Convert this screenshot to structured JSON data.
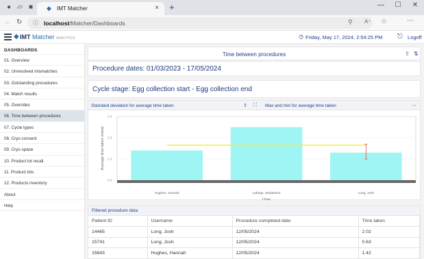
{
  "browser": {
    "tab_title": "IMT Matcher",
    "url_host": "localhost",
    "url_path": "/Matcher/Dashboards",
    "new_tab_glyph": "+",
    "close_glyph": "×"
  },
  "header": {
    "logo_imt": "IMT",
    "logo_matcher": "Matcher",
    "logo_sub": "ANALYTICS",
    "datetime": "Friday, May 17, 2024, 2:54:25 PM",
    "logoff": "Logoff"
  },
  "sidebar": {
    "heading": "DASHBOARDS",
    "items": [
      {
        "label": "01. Overview"
      },
      {
        "label": "02. Unresolved mismatches"
      },
      {
        "label": "03. Outstanding procedures"
      },
      {
        "label": "04. Match results"
      },
      {
        "label": "05. Overrides"
      },
      {
        "label": "06. Time between procedures"
      },
      {
        "label": "07. Cycle types"
      },
      {
        "label": "08. Cryo consent"
      },
      {
        "label": "09. Cryo space"
      },
      {
        "label": "10. Product lot recall"
      },
      {
        "label": "11. Product lots"
      },
      {
        "label": "12. Products inventory"
      },
      {
        "label": "About"
      },
      {
        "label": "Help"
      }
    ],
    "active_index": 5
  },
  "main": {
    "title": "Time between procedures",
    "procedure_dates": "Procedure dates: 01/03/2023 - 17/05/2024",
    "cycle_stage": "Cycle stage: Egg collection start - Egg collection end",
    "chart_tab_left": "Standard deviation for average time taken",
    "chart_tab_right": "Max and min for average time taken"
  },
  "chart_data": {
    "type": "bar",
    "categories": [
      "Hughes, Hannah",
      "Lafarge, Madeleine",
      "Long, Josh"
    ],
    "values": [
      1.4,
      2.5,
      1.3
    ],
    "mean_line": 1.65,
    "error_bar_long_josh": [
      1.0,
      1.7
    ],
    "ylabel": "Average time taken (mins)",
    "xlabel": "User",
    "yticks": [
      "0.0",
      "1.0",
      "2.0",
      "3.0"
    ],
    "ylim": [
      0,
      3
    ],
    "bar_color": "#9ff5f3",
    "mean_line_color": "#f0ee4a",
    "error_color": "#d9534f"
  },
  "table": {
    "caption": "Filtered procedure data",
    "headers": [
      "Patient ID",
      "Username",
      "Procedure completed date",
      "Time taken"
    ],
    "rows": [
      [
        "14465",
        "Long, Josh",
        "12/05/2024",
        "2.02"
      ],
      [
        "15741",
        "Long, Josh",
        "12/05/2024",
        "0.63"
      ],
      [
        "15843",
        "Hughes, Hannah",
        "12/05/2024",
        "1.42"
      ]
    ]
  }
}
